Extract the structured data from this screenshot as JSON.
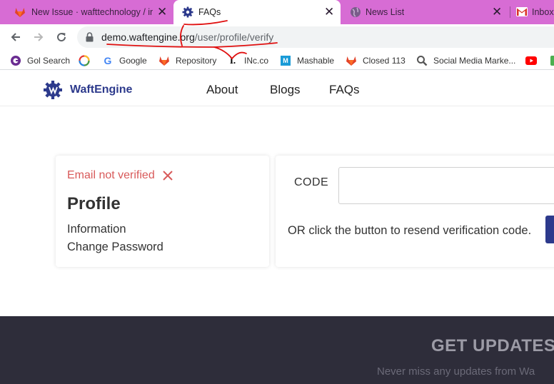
{
  "browser": {
    "tabs": [
      {
        "title": "New Issue · wafttechnology / inf",
        "icon": "gitlab-icon",
        "active": false
      },
      {
        "title": "FAQs",
        "icon": "waftengine-gear-icon",
        "active": true
      },
      {
        "title": "News List",
        "icon": "globe-icon",
        "active": false
      },
      {
        "title": "Inbox",
        "icon": "gmail-icon",
        "active": false
      }
    ],
    "url_host": "demo.waftengine.org",
    "url_path": "/user/profile/verify",
    "bookmarks": [
      {
        "label": "Gol Search",
        "icon": "gol-search-icon"
      },
      {
        "label": "",
        "icon": "opera-icon"
      },
      {
        "label": "Google",
        "icon": "google-icon"
      },
      {
        "label": "Repository",
        "icon": "gitlab-icon"
      },
      {
        "label": "INc.co",
        "icon": "inc-icon"
      },
      {
        "label": "Mashable",
        "icon": "mashable-icon"
      },
      {
        "label": "Closed 113",
        "icon": "gitlab-icon"
      },
      {
        "label": "Social Media Marke...",
        "icon": "magnifier-icon"
      },
      {
        "label": "",
        "icon": "youtube-icon"
      }
    ]
  },
  "site": {
    "brand": "WaftEngine",
    "nav": [
      "About",
      "Blogs",
      "FAQs"
    ]
  },
  "profile_card": {
    "alert": "Email not verified",
    "title": "Profile",
    "links": [
      "Information",
      "Change Password"
    ]
  },
  "verify_card": {
    "code_label": "CODE",
    "code_value": "",
    "resend_text": "OR click the button to resend verification code."
  },
  "footer": {
    "title": "GET UPDATES",
    "subtitle": "Never miss any updates from Wa"
  },
  "colors": {
    "tab_strip": "#d76cd4",
    "brand": "#2d3a8c",
    "alert": "#d85a5a",
    "footer_bg": "#2e2d3a",
    "annotation": "#e01010"
  }
}
